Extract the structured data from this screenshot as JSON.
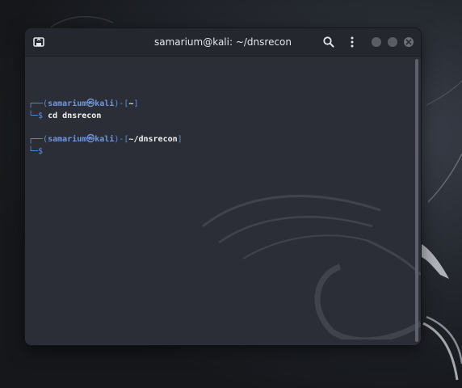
{
  "window": {
    "title": "samarium@kali: ~/dnsrecon"
  },
  "terminal": {
    "lines": [
      {
        "user": "samarium",
        "host": "kali",
        "dir": "~",
        "command": "cd dnsrecon"
      },
      {
        "user": "samarium",
        "host": "kali",
        "dir": "~/dnsrecon",
        "command": ""
      }
    ],
    "prompt_symbol": "$"
  },
  "icons": {
    "new_tab": "new-tab-icon",
    "search": "search-icon",
    "menu": "kebab-menu-icon",
    "minimize": "minimize-icon",
    "maximize": "maximize-icon",
    "close": "close-icon"
  },
  "colors": {
    "prompt_blue": "#5f8fd6",
    "titlebar": "#25272e",
    "terminal_bg": "#2b2e37"
  }
}
